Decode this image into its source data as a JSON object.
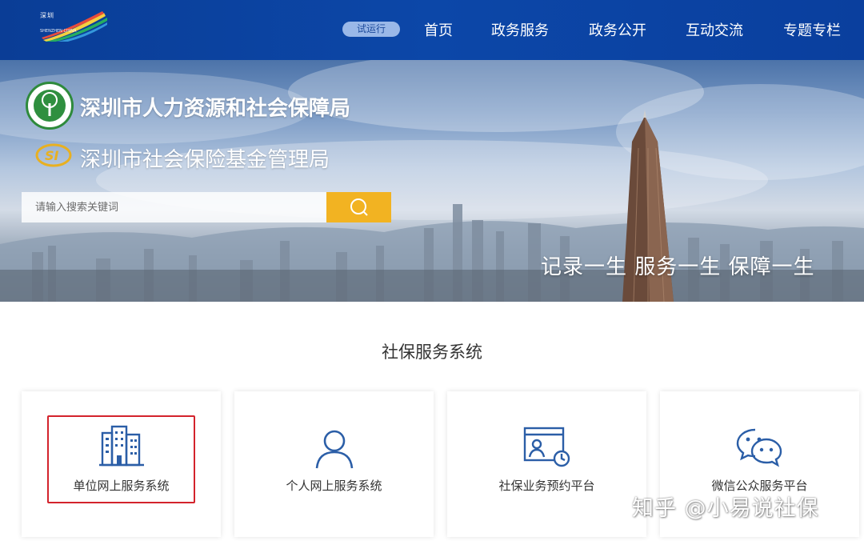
{
  "header": {
    "logo_text": "深圳",
    "logo_sub": "SHENZHEN CHINA",
    "trial_badge": "试运行",
    "nav": [
      "首页",
      "政务服务",
      "政务公开",
      "互动交流",
      "专题专栏"
    ]
  },
  "banner": {
    "org_primary": "深圳市人力资源和社会保障局",
    "org_secondary": "深圳市社会保险基金管理局",
    "emblem_secondary_text": "SI",
    "search": {
      "placeholder": "请输入搜索关键词",
      "button_icon": "search-icon"
    },
    "slogan": "记录一生   服务一生   保障一生"
  },
  "section": {
    "title": "社保服务系统",
    "cards": [
      {
        "label": "单位网上服务系统",
        "icon": "building-icon"
      },
      {
        "label": "个人网上服务系统",
        "icon": "person-icon"
      },
      {
        "label": "社保业务预约平台",
        "icon": "calendar-clock-icon"
      },
      {
        "label": "微信公众服务平台",
        "icon": "wechat-icon"
      }
    ]
  },
  "watermark": "知乎 @小易说社保",
  "colors": {
    "header_bg": "#0c47a8",
    "trial_badge_bg": "#9ab8e8",
    "search_button": "#f2b322",
    "icon_blue": "#2b5ea7",
    "highlight_border": "#d3232c"
  }
}
